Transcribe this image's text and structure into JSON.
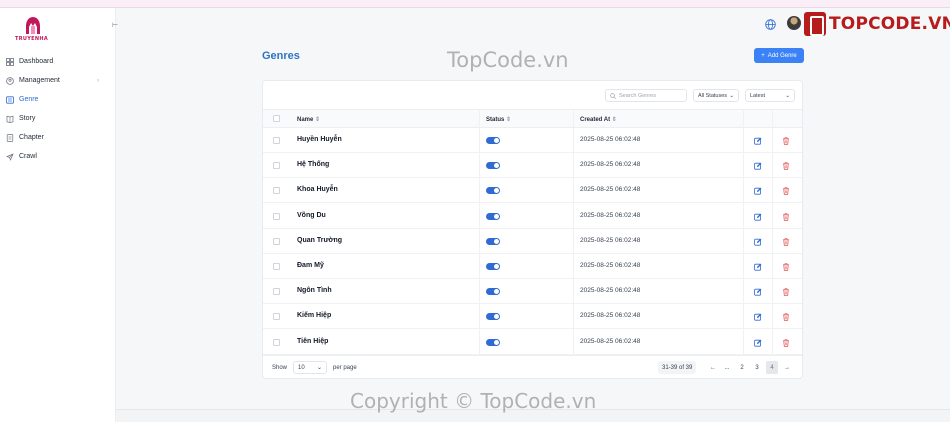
{
  "brand": {
    "logo_text": "TRUYENHA",
    "watermark_top": "TopCode.vn",
    "watermark_bottom": "Copyright © TopCode.vn",
    "corner_brand": "TOPCODE.VN"
  },
  "sidebar": {
    "collapse_glyph": "⊢",
    "items": [
      {
        "label": "Dashboard",
        "icon": "grid-icon"
      },
      {
        "label": "Management",
        "icon": "user-circle-icon",
        "arrow": "›"
      },
      {
        "label": "Genre",
        "icon": "list-icon",
        "active": true
      },
      {
        "label": "Story",
        "icon": "book-icon"
      },
      {
        "label": "Chapter",
        "icon": "file-icon"
      },
      {
        "label": "Crawl",
        "icon": "rocket-icon"
      }
    ]
  },
  "page": {
    "title": "Genres",
    "add_button": "Add Genre",
    "add_icon": "+"
  },
  "toolbar": {
    "search_placeholder": "Search Genres",
    "status_filter": "All Statuses",
    "sort": "Latest",
    "caret": "⌄"
  },
  "table": {
    "headers": {
      "name": "Name",
      "status": "Status",
      "created": "Created At",
      "sort_glyph": "⇕"
    },
    "rows": [
      {
        "name": "Huyền Huyễn",
        "status": true,
        "created": "2025-08-25 06:02:48"
      },
      {
        "name": "Hệ Thống",
        "status": true,
        "created": "2025-08-25 06:02:48"
      },
      {
        "name": "Khoa Huyễn",
        "status": true,
        "created": "2025-08-25 06:02:48"
      },
      {
        "name": "Võng Du",
        "status": true,
        "created": "2025-08-25 06:02:48"
      },
      {
        "name": "Quan Trường",
        "status": true,
        "created": "2025-08-25 06:02:48"
      },
      {
        "name": "Đam Mỹ",
        "status": true,
        "created": "2025-08-25 06:02:48"
      },
      {
        "name": "Ngôn Tình",
        "status": true,
        "created": "2025-08-25 06:02:48"
      },
      {
        "name": "Kiếm Hiệp",
        "status": true,
        "created": "2025-08-25 06:02:48"
      },
      {
        "name": "Tiên Hiệp",
        "status": true,
        "created": "2025-08-25 06:02:48"
      }
    ]
  },
  "pagination": {
    "show_label": "Show",
    "per_page_value": "10",
    "per_page_label": "per page",
    "range": "31-39 of 39",
    "prev": "←",
    "ellipsis": "...",
    "pages": [
      "2",
      "3",
      "4"
    ],
    "next": "→",
    "current": "4"
  },
  "colors": {
    "accent": "#2f6bd3",
    "title": "#2f74c0",
    "delete": "#e05656",
    "brand": "#b71c1c"
  }
}
